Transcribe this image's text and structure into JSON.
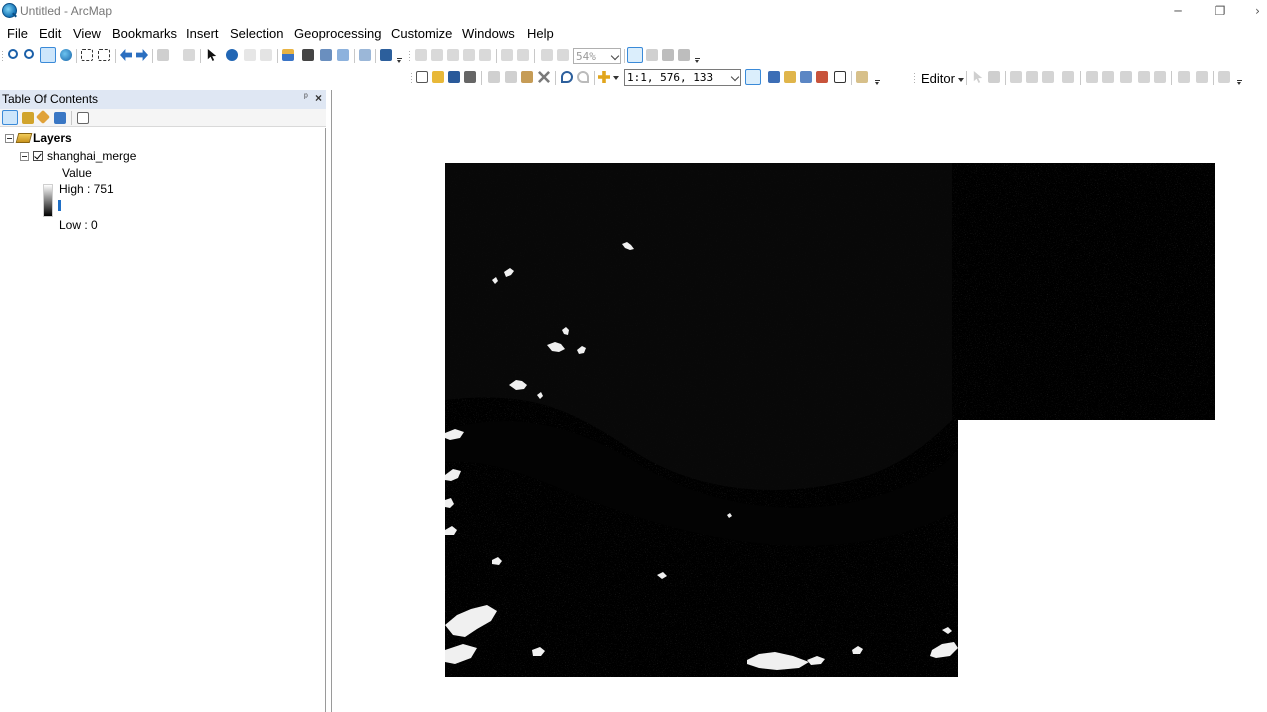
{
  "window": {
    "title": "Untitled - ArcMap",
    "minimize_glyph": "─",
    "restore_glyph": "❐",
    "close_glyph": "›"
  },
  "menu": [
    "File",
    "Edit",
    "View",
    "Bookmarks",
    "Insert",
    "Selection",
    "Geoprocessing",
    "Customize",
    "Windows",
    "Help"
  ],
  "toolbars": {
    "layout_zoom_value": "54%",
    "map_scale_value": "1:1, 576, 133",
    "editor_label": "Editor"
  },
  "toc": {
    "title": "Table Of Contents",
    "pin_glyph": "ᵖ",
    "close_glyph": "×",
    "root": {
      "label": "Layers",
      "layers": [
        {
          "name": "shanghai_merge",
          "checked": true,
          "legend_heading": "Value",
          "high_label": "High : 751",
          "low_label": "Low : 0"
        }
      ]
    }
  },
  "map": {
    "background": "#ffffff",
    "raster_color": "#000000",
    "highlight_color": "#f2f2f2"
  },
  "colors": {
    "toc_header": "#dfe7f3",
    "accent_blue": "#1f6fc6",
    "selection_highlight": "#5bb0f0"
  }
}
